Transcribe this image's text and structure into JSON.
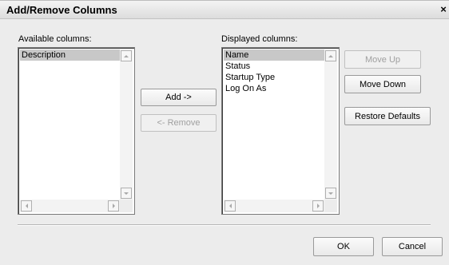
{
  "dialog": {
    "title": "Add/Remove Columns",
    "close_label": "×"
  },
  "available": {
    "label": "Available columns:",
    "items": [
      "Description"
    ]
  },
  "displayed": {
    "label": "Displayed columns:",
    "items": [
      "Name",
      "Status",
      "Startup Type",
      "Log On As"
    ]
  },
  "buttons": {
    "add": "Add ->",
    "remove": "<- Remove",
    "move_up": "Move Up",
    "move_down": "Move Down",
    "restore_defaults": "Restore Defaults",
    "ok": "OK",
    "cancel": "Cancel"
  },
  "colors": {
    "selection": "#c8c8c8",
    "disabled_text": "#a0a0a0"
  }
}
